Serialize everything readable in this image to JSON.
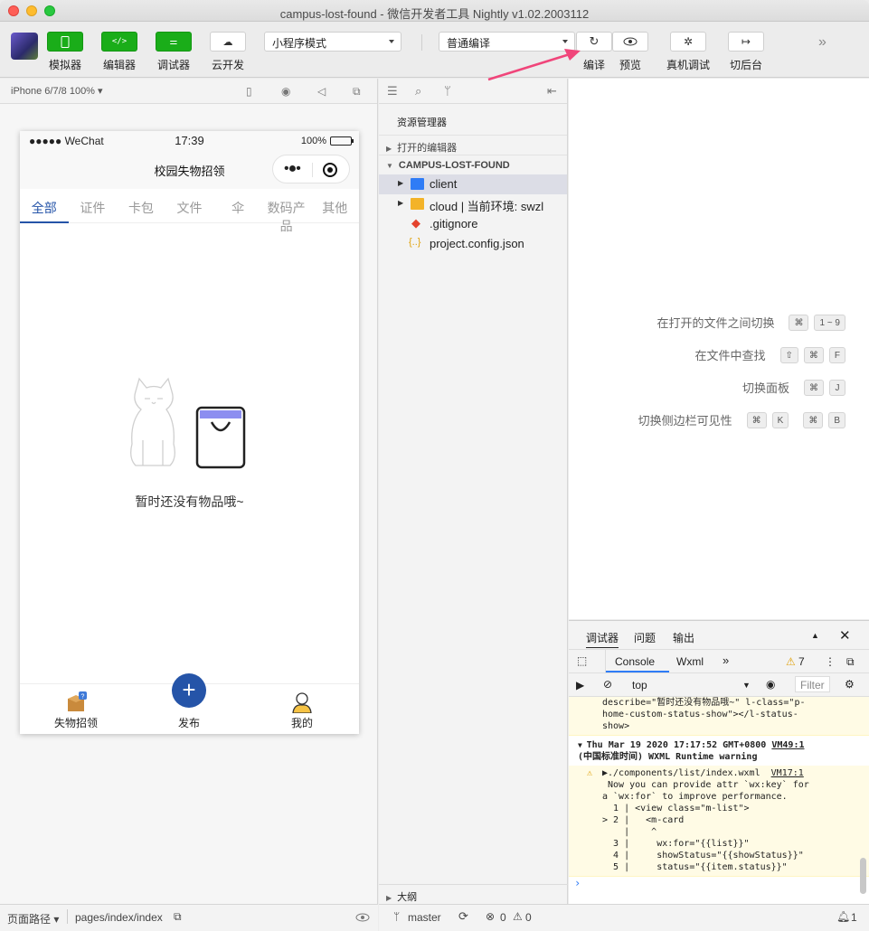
{
  "window": {
    "title": "campus-lost-found - 微信开发者工具 Nightly v1.02.2003112"
  },
  "toolbar": {
    "simulator": "模拟器",
    "editor": "编辑器",
    "debugger": "调试器",
    "cloud": "云开发",
    "mode_select": "小程序模式",
    "compile_select": "普通编译",
    "compile": "编译",
    "preview": "预览",
    "device_debug": "真机调试",
    "background": "切后台"
  },
  "simulator": {
    "device": "iPhone 6/7/8 100% ▾",
    "status": {
      "carrier": "●●●●● WeChat",
      "time": "17:39",
      "battery": "100%"
    },
    "nav_title": "校园失物招领",
    "tabs": [
      "全部",
      "证件",
      "卡包",
      "文件",
      "伞",
      "数码产品",
      "其他"
    ],
    "empty_text": "暂时还没有物品哦~",
    "tabbar": {
      "lost": "失物招领",
      "publish": "发布",
      "mine": "我的"
    }
  },
  "simfooter": {
    "path_label": "页面路径 ▾",
    "path": "pages/index/index"
  },
  "explorer": {
    "title": "资源管理器",
    "open_editors": "打开的编辑器",
    "project": "CAMPUS-LOST-FOUND",
    "files": [
      ".gitignore",
      "project.config.json"
    ],
    "folders": [
      "client",
      "cloud | 当前环境: swzl"
    ],
    "outline": "大纲"
  },
  "footer": {
    "branch": "master",
    "errors": "0",
    "warnings": "0",
    "notifications": "1"
  },
  "editor": {
    "shortcuts": [
      {
        "label": "在打开的文件之间切换",
        "keys": [
          "⌘",
          "1 ~ 9"
        ]
      },
      {
        "label": "在文件中查找",
        "keys": [
          "⇧",
          "⌘",
          "F"
        ]
      },
      {
        "label": "切换面板",
        "keys": [
          "⌘",
          "J"
        ]
      },
      {
        "label": "切换侧边栏可见性",
        "keys": [
          "⌘",
          "K",
          "⌘",
          "B"
        ]
      }
    ]
  },
  "console": {
    "tabs": [
      "调试器",
      "问题",
      "输出"
    ],
    "devtools_tabs": [
      "Console",
      "Wxml"
    ],
    "warn_count": "7",
    "context": "top",
    "filter": "Filter",
    "log_lines_top": [
      "describe=\"暂时还没有物品哦~\" l-class=\"p-",
      "home-custom-status-show\"></l-status-",
      "show>"
    ],
    "group_header": "Thu Mar 19 2020 17:17:52 GMT+0800",
    "group_header_link": "VM49:1",
    "group_header2": "(中国标准时间) WXML Runtime warning",
    "warn_file": "▶./components/list/index.wxml",
    "warn_link": "VM17:1",
    "warn_lines": [
      "Now you can provide attr `wx:key` for",
      "a `wx:for` to improve performance.",
      "  1 | <view class=\"m-list\">",
      "> 2 |   <m-card",
      "    |    ^",
      "  3 |     wx:for=\"{{list}}\"",
      "  4 |     showStatus=\"{{showStatus}}\"",
      "  5 |     status=\"{{item.status}}\""
    ]
  },
  "colors": {
    "accent": "#2554a8",
    "green": "#1aad19",
    "arrow": "#f0457a"
  }
}
